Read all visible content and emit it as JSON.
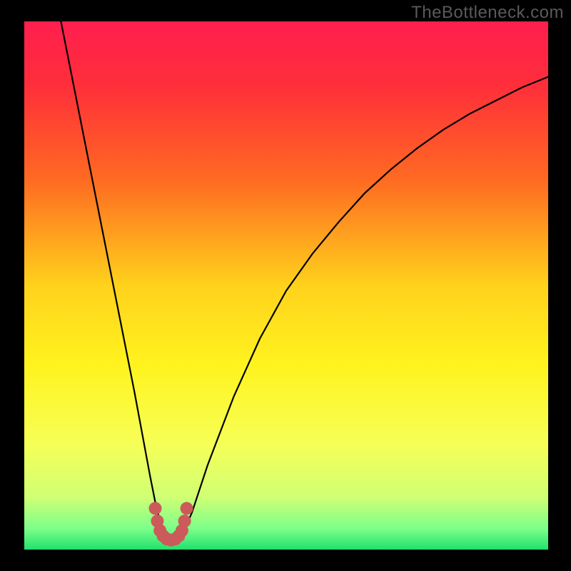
{
  "watermark": "TheBottleneck.com",
  "colors": {
    "frame": "#000000",
    "gradient_stops": [
      {
        "offset": 0.0,
        "color": "#ff1f4f"
      },
      {
        "offset": 0.12,
        "color": "#ff2e3a"
      },
      {
        "offset": 0.3,
        "color": "#ff6a22"
      },
      {
        "offset": 0.5,
        "color": "#ffd21c"
      },
      {
        "offset": 0.65,
        "color": "#fff31e"
      },
      {
        "offset": 0.8,
        "color": "#f6ff56"
      },
      {
        "offset": 0.9,
        "color": "#d0ff74"
      },
      {
        "offset": 0.96,
        "color": "#7dff8a"
      },
      {
        "offset": 1.0,
        "color": "#22e06e"
      }
    ],
    "curve": "#000000",
    "marker": "#cc5a5a"
  },
  "chart_data": {
    "type": "line",
    "title": "",
    "xlabel": "",
    "ylabel": "",
    "xlim": [
      0,
      100
    ],
    "ylim": [
      0,
      100
    ],
    "notes": "Axes have no visible tick labels; x is a normalized horizontal position (0=left edge of plot area, 100=right edge) and y is a normalized vertical value (0=bottom, 100=top). Values estimated from pixel positions.",
    "series": [
      {
        "name": "curve",
        "x": [
          7,
          9,
          11,
          13,
          15,
          17,
          19,
          21,
          22.5,
          24,
          25,
          26,
          27,
          28,
          29,
          30,
          32,
          35,
          40,
          45,
          50,
          55,
          60,
          65,
          70,
          75,
          80,
          85,
          90,
          95,
          100
        ],
        "values": [
          100,
          90,
          80,
          70,
          60,
          50,
          40,
          30,
          22,
          14,
          9,
          5,
          2.5,
          1.5,
          1.5,
          2.5,
          7,
          16,
          29,
          40,
          49,
          56,
          62,
          67.5,
          72,
          76,
          79.5,
          82.5,
          85,
          87.5,
          89.5
        ]
      },
      {
        "name": "highlight-markers",
        "x": [
          25.0,
          25.4,
          25.9,
          26.5,
          27.2,
          28.0,
          28.8,
          29.5,
          30.1,
          30.6,
          31.0
        ],
        "values": [
          7.8,
          5.4,
          3.6,
          2.6,
          2.0,
          1.8,
          2.0,
          2.6,
          3.6,
          5.4,
          7.8
        ]
      }
    ]
  }
}
